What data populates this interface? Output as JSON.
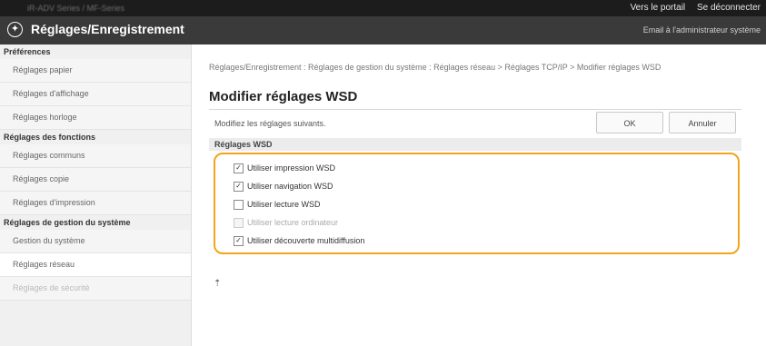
{
  "header": {
    "device_name": "iR-ADV Series / MF-Series",
    "portal_link": "Vers le portail",
    "logout_link": "Se déconnecter",
    "app_title": "Réglages/Enregistrement",
    "admin_mail": "Email à l'administrateur système"
  },
  "sidebar": {
    "sections": [
      {
        "title": "Préférences",
        "items": [
          "Réglages papier",
          "Réglages d'affichage",
          "Réglages horloge"
        ]
      },
      {
        "title": "Réglages des fonctions",
        "items": [
          "Réglages communs",
          "Réglages copie",
          "Réglages d'impression"
        ]
      },
      {
        "title": "Réglages de gestion du système",
        "items": [
          "Gestion du système",
          "Réglages réseau",
          "Réglages de sécurité"
        ]
      }
    ],
    "active_item": "Réglages réseau"
  },
  "main": {
    "breadcrumb": "Réglages/Enregistrement : Réglages de gestion du système : Réglages réseau > Réglages TCP/IP > Modifier réglages WSD",
    "title": "Modifier réglages WSD",
    "instruction": "Modifiez les réglages suivants.",
    "ok_label": "OK",
    "cancel_label": "Annuler",
    "section_title": "Réglages WSD",
    "options": [
      {
        "label": "Utiliser impression WSD",
        "checked": true,
        "disabled": false
      },
      {
        "label": "Utiliser navigation WSD",
        "checked": true,
        "disabled": false
      },
      {
        "label": "Utiliser lecture WSD",
        "checked": false,
        "disabled": false
      },
      {
        "label": "Utiliser lecture ordinateur",
        "checked": false,
        "disabled": true
      },
      {
        "label": "Utiliser découverte multidiffusion",
        "checked": true,
        "disabled": false
      }
    ],
    "top_arrow": "⇡"
  },
  "colors": {
    "highlight_border": "#f3a41b",
    "titlebar": "#3a3a3a",
    "topbar": "#1c1c1c"
  }
}
